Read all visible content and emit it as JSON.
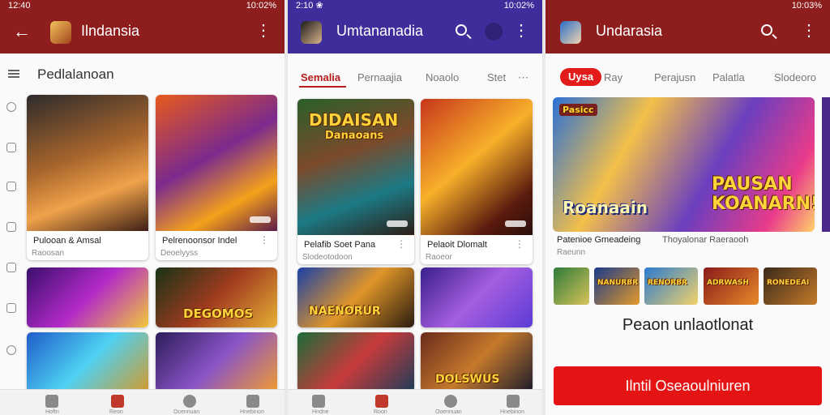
{
  "screens": [
    {
      "status": {
        "time": "12:40",
        "right": "10:02%"
      },
      "appbar": {
        "title": "Ilndansia",
        "color": "#8e1d1d"
      },
      "section_title": "Pedlalanoan",
      "cards": [
        {
          "title": "Pulooan & Amsal",
          "sub": "Raoosan"
        },
        {
          "title": "Pelrenoonsor Indel",
          "sub": "Deoelyyss"
        }
      ],
      "tiles": [
        "",
        "DEGOMOS",
        "",
        ""
      ],
      "bottom_nav": [
        "Hoftn",
        "Reon",
        "Ocennuan",
        "Hnebinon"
      ]
    },
    {
      "status": {
        "time": "2:10 ❀",
        "right": "10:02%"
      },
      "appbar": {
        "title": "Umtananadia",
        "color": "#3f2d9c"
      },
      "tabs": [
        "Semalia",
        "Pernaajia",
        "Noaolo",
        "Stet"
      ],
      "cards": [
        {
          "title": "Pelafib Soet Pana",
          "sub": "Slodeotodoon",
          "art": "DIDAISAN\nDanaoans"
        },
        {
          "title": "Pelaoit Dlomalt",
          "sub": "Raoeor"
        }
      ],
      "tiles": [
        "NAENORUR",
        "",
        "",
        "DOLSWUS"
      ],
      "bottom_nav": [
        "Hndne",
        "Roon",
        "Ooennuan",
        "Hnebinon"
      ]
    },
    {
      "status": {
        "time": "",
        "right": "10:03%"
      },
      "appbar": {
        "title": "Undarasia",
        "color": "#8e1d1d"
      },
      "tabs": [
        "Uysa",
        "Ray",
        "Perajusn",
        "Palatla",
        "Slodeoro"
      ],
      "hero": {
        "badge": "Pasicc",
        "label_left": "Roanaain",
        "label_right": "PAUSAN\nKOANARN!"
      },
      "info": {
        "left": "Patenioe Gmeadeing",
        "right": "Thoyalonar Raeraooh",
        "sub": "Raeunn"
      },
      "mini_tiles": [
        "",
        "NANURBR",
        "RENORBR",
        "ADRWASH",
        "RONEDEAI"
      ],
      "promo_text": "Peaon unlaotlonat",
      "cta_label": "Ilntil Oseaoulniuren"
    }
  ]
}
